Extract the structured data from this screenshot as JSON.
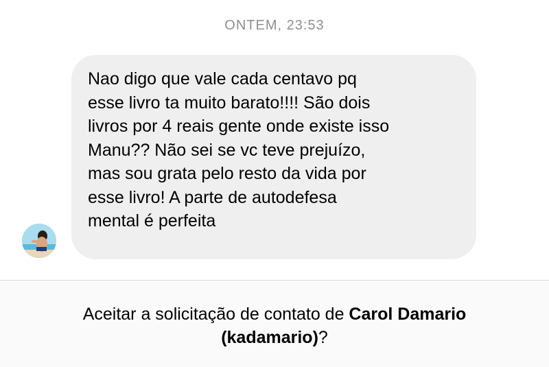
{
  "conversation": {
    "timestamp": "ONTEM, 23:53",
    "message": {
      "text": "Nao digo que vale cada centavo pq\nesse livro ta muito barato!!!! São dois\nlivros por 4 reais gente onde existe isso\nManu?? Não sei se vc teve prejuízo,\nmas sou grata pelo resto da vida por\nesse livro! A parte de autodefesa\nmental é perfeita"
    }
  },
  "request": {
    "prefix": "Aceitar a solicitação de contato de ",
    "name": "Carol Damario",
    "username": "(kadamario)",
    "suffix": "?"
  }
}
